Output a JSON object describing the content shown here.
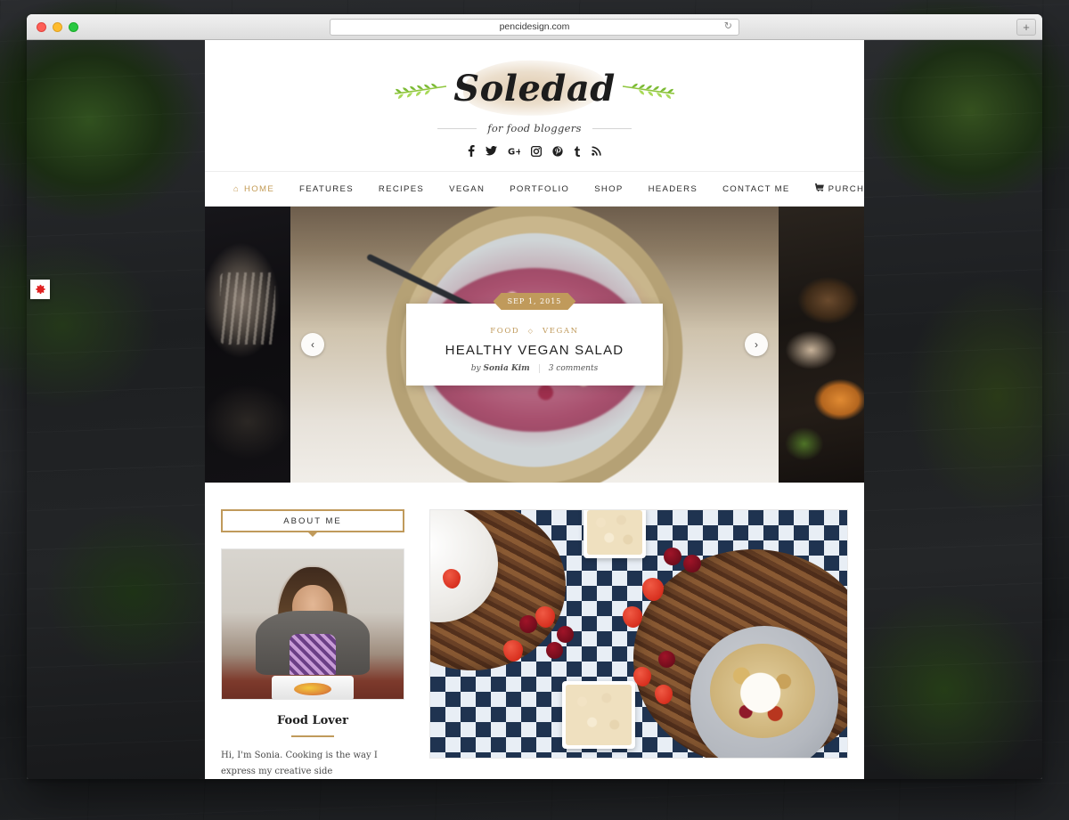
{
  "browser": {
    "url": "pencidesign.com",
    "reload_icon": "reload-icon",
    "new_tab_icon": "plus-icon",
    "traffic_lights": [
      "close",
      "minimize",
      "zoom"
    ]
  },
  "desktop": {
    "settings_icon": "gear-icon"
  },
  "site": {
    "logo_text": "Soledad",
    "tagline": "for food bloggers",
    "socials": [
      {
        "name": "facebook-icon",
        "glyph": "f"
      },
      {
        "name": "twitter-icon",
        "glyph": "✈"
      },
      {
        "name": "google-plus-icon",
        "glyph": "G+"
      },
      {
        "name": "instagram-icon",
        "glyph": "▣"
      },
      {
        "name": "pinterest-icon",
        "glyph": "Ⓟ"
      },
      {
        "name": "tumblr-icon",
        "glyph": "t"
      },
      {
        "name": "rss-icon",
        "glyph": "➶"
      }
    ],
    "nav": {
      "items": [
        {
          "label": "HOME",
          "icon": "home-icon",
          "active": true
        },
        {
          "label": "FEATURES",
          "icon": "",
          "active": false
        },
        {
          "label": "RECIPES",
          "icon": "",
          "active": false
        },
        {
          "label": "VEGAN",
          "icon": "",
          "active": false
        },
        {
          "label": "PORTFOLIO",
          "icon": "",
          "active": false
        },
        {
          "label": "SHOP",
          "icon": "",
          "active": false
        },
        {
          "label": "HEADERS",
          "icon": "",
          "active": false
        },
        {
          "label": "CONTACT ME",
          "icon": "",
          "active": false
        },
        {
          "label": "PURCHASE",
          "icon": "cart-icon",
          "active": false
        }
      ],
      "search_icon": "search-icon"
    },
    "slider": {
      "prev_label": "‹",
      "next_label": "›",
      "caption": {
        "date": "SEP 1, 2015",
        "categories": [
          "FOOD",
          "VEGAN"
        ],
        "separator": "◇",
        "title": "HEALTHY VEGAN SALAD",
        "by_prefix": "by",
        "author": "Sonia Kim",
        "comments": "3 comments"
      }
    },
    "about": {
      "box_label": "ABOUT ME",
      "photo_alt": "sonia-portrait",
      "name": "Food Lover",
      "bio": "Hi, I'm Sonia. Cooking is the way I express my creative side"
    },
    "feature": {
      "photo_alt": "granola-bowls-gingham-photo"
    }
  },
  "colors": {
    "accent_gold": "#c09a5b",
    "text_dark": "#232323",
    "nav_active": "#c39b55"
  }
}
